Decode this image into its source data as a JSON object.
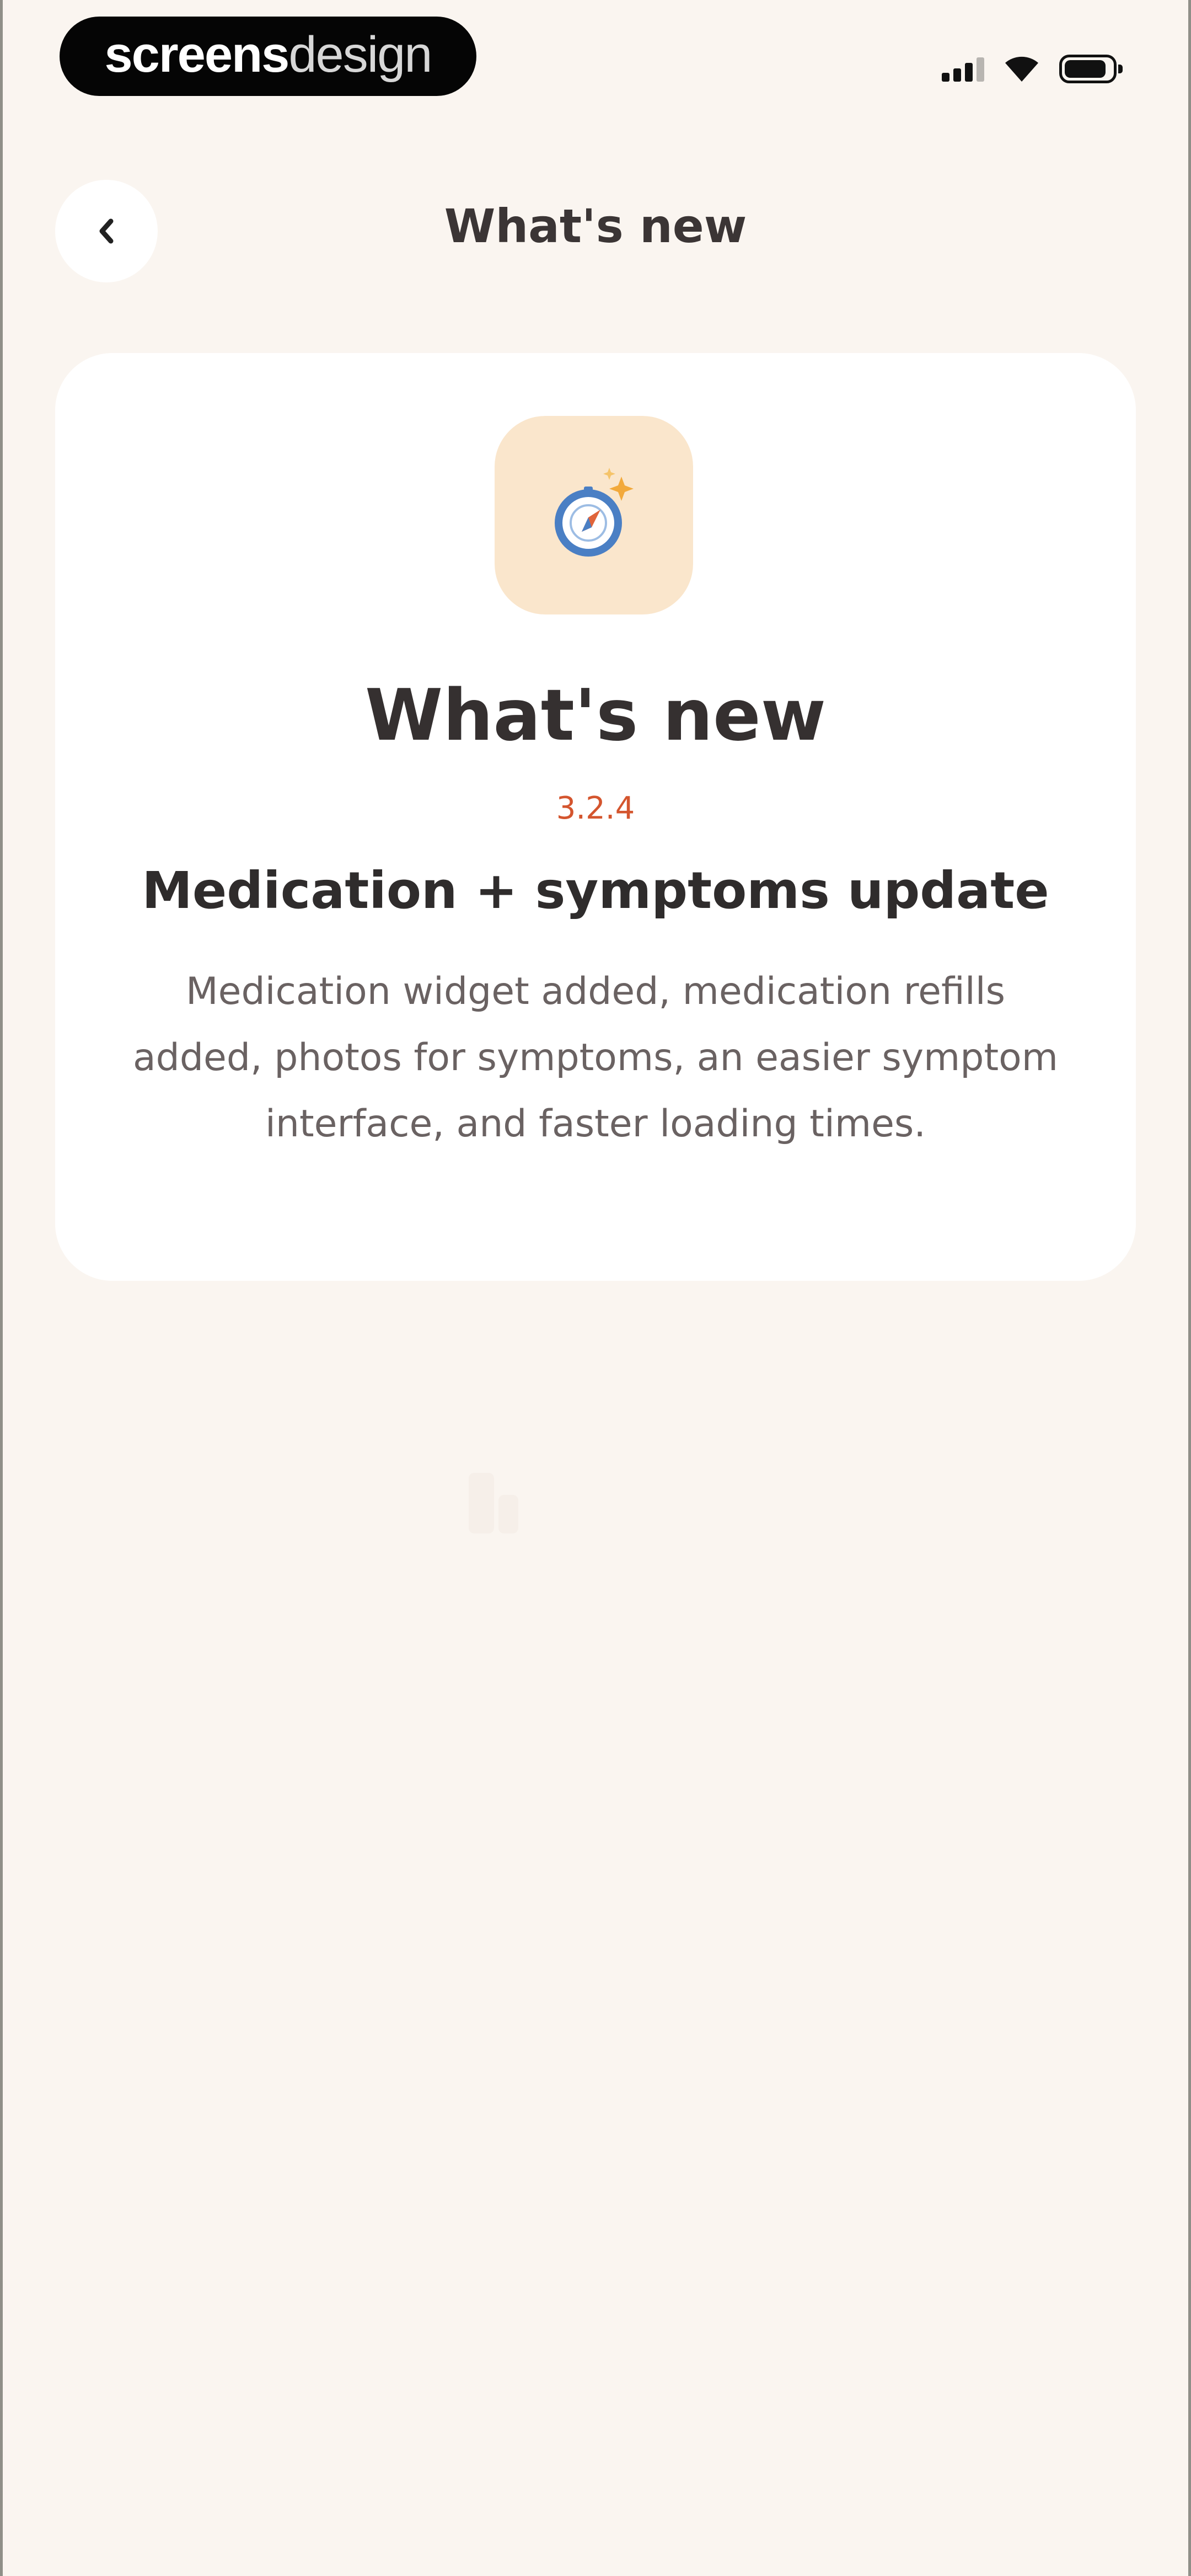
{
  "status_bar": {
    "brand_strong": "screens",
    "brand_light": "design",
    "icons": [
      "signal-icon",
      "wifi-icon",
      "battery-icon"
    ]
  },
  "header": {
    "back_icon": "chevron-left-icon",
    "title": "What's new"
  },
  "card": {
    "icon": "compass-sparkle-icon",
    "title": "What's new",
    "version": "3.2.4",
    "update_title": "Medication + symptoms update",
    "update_description": "Medication widget added, medication refills added, photos for symptoms, an easier symptom interface, and faster loading times."
  },
  "colors": {
    "background": "#faf5f0",
    "card_background": "#ffffff",
    "icon_tile": "#fae6cc",
    "version_accent": "#d4552e",
    "compass_blue": "#4a7fc4"
  }
}
